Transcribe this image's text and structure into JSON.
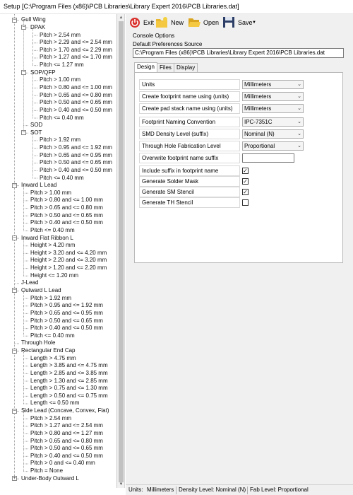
{
  "window": {
    "title": "Setup [C:\\Program Files (x86)\\PCB Libraries\\Library Expert 2016\\PCB Libraries.dat]"
  },
  "toolbar": {
    "exit_label": "Exit",
    "new_label": "New",
    "open_label": "Open",
    "save_label": "Save"
  },
  "console": {
    "group_label": "Console Options",
    "pref_label": "Default Preferences Source",
    "pref_path": "C:\\Program Files (x86)\\PCB Libraries\\Library Expert 2016\\PCB Libraries.dat"
  },
  "tabs": [
    {
      "label": "Design",
      "active": true
    },
    {
      "label": "Files",
      "active": false
    },
    {
      "label": "Display",
      "active": false
    }
  ],
  "properties": [
    {
      "label": "Units",
      "kind": "select",
      "value": "Millimeters"
    },
    {
      "label": "Create footprint name using (units)",
      "kind": "select",
      "value": "Millimeters"
    },
    {
      "label": "Create pad stack name using (units)",
      "kind": "select",
      "value": "Millimeters"
    },
    {
      "label": "Footprint Naming Convention",
      "kind": "select",
      "value": "IPC-7351C"
    },
    {
      "label": "SMD Density Level (suffix)",
      "kind": "select",
      "value": "Nominal (N)"
    },
    {
      "label": "Through Hole Fabrication Level",
      "kind": "select",
      "value": "Proportional"
    },
    {
      "label": "Overwrite footprint name suffix",
      "kind": "text",
      "value": ""
    },
    {
      "label": "Include suffix in footprint name",
      "kind": "check",
      "checked": true
    },
    {
      "label": "Generate Solder Mask",
      "kind": "check",
      "checked": true
    },
    {
      "label": "Generate SM Stencil",
      "kind": "check",
      "checked": true
    },
    {
      "label": "Generate TH Stencil",
      "kind": "check",
      "checked": false
    }
  ],
  "status": {
    "units_label": "Units:",
    "units_value": "Millimeters",
    "density": "Density Level: Nominal (N)",
    "fab": "Fab Level: Proportional"
  },
  "tree": [
    {
      "text": "Gull Wing",
      "level": 1,
      "expanded": true
    },
    {
      "text": "DPAK",
      "level": 2,
      "expanded": true
    },
    {
      "text": "Pitch > 2.54 mm",
      "level": 3
    },
    {
      "text": "Pitch > 2.29 and <= 2.54 mm",
      "level": 3
    },
    {
      "text": "Pitch > 1.70 and <= 2.29 mm",
      "level": 3
    },
    {
      "text": "Pitch > 1.27 and <= 1.70 mm",
      "level": 3
    },
    {
      "text": "Pitch <= 1.27 mm",
      "level": 3
    },
    {
      "text": "SOP/QFP",
      "level": 2,
      "expanded": true
    },
    {
      "text": "Pitch > 1.00 mm",
      "level": 3
    },
    {
      "text": "Pitch > 0.80 and <= 1.00 mm",
      "level": 3
    },
    {
      "text": "Pitch > 0.65 and <= 0.80 mm",
      "level": 3
    },
    {
      "text": "Pitch > 0.50 and <= 0.65 mm",
      "level": 3
    },
    {
      "text": "Pitch > 0.40 and <= 0.50 mm",
      "level": 3
    },
    {
      "text": "Pitch <= 0.40 mm",
      "level": 3
    },
    {
      "text": "SOD",
      "level": 2
    },
    {
      "text": "SOT",
      "level": 2,
      "expanded": true
    },
    {
      "text": "Pitch > 1.92 mm",
      "level": 3
    },
    {
      "text": "Pitch > 0.95 and <= 1.92 mm",
      "level": 3
    },
    {
      "text": "Pitch > 0.65 and <= 0.95 mm",
      "level": 3
    },
    {
      "text": "Pitch > 0.50 and <= 0.65 mm",
      "level": 3
    },
    {
      "text": "Pitch > 0.40 and <= 0.50 mm",
      "level": 3
    },
    {
      "text": "Pitch <= 0.40 mm",
      "level": 3
    },
    {
      "text": "Inward L Lead",
      "level": 1,
      "expanded": true
    },
    {
      "text": "Pitch > 1.00 mm",
      "level": 2
    },
    {
      "text": "Pitch > 0.80 and <= 1.00 mm",
      "level": 2
    },
    {
      "text": "Pitch > 0.65 and <= 0.80 mm",
      "level": 2
    },
    {
      "text": "Pitch > 0.50 and <= 0.65 mm",
      "level": 2
    },
    {
      "text": "Pitch > 0.40 and <= 0.50 mm",
      "level": 2
    },
    {
      "text": "Pitch <= 0.40 mm",
      "level": 2
    },
    {
      "text": "Inward Flat Ribbon L",
      "level": 1,
      "expanded": true
    },
    {
      "text": "Height > 4.20 mm",
      "level": 2
    },
    {
      "text": "Height > 3.20 and <= 4.20 mm",
      "level": 2
    },
    {
      "text": "Height > 2.20 and <= 3.20 mm",
      "level": 2
    },
    {
      "text": "Height > 1.20 and <= 2.20 mm",
      "level": 2
    },
    {
      "text": "Height <= 1.20 mm",
      "level": 2
    },
    {
      "text": "J-Lead",
      "level": 1
    },
    {
      "text": "Outward L Lead",
      "level": 1,
      "expanded": true
    },
    {
      "text": "Pitch > 1.92 mm",
      "level": 2
    },
    {
      "text": "Pitch > 0.95 and <= 1.92 mm",
      "level": 2
    },
    {
      "text": "Pitch > 0.65 and <= 0.95 mm",
      "level": 2
    },
    {
      "text": "Pitch > 0.50 and <= 0.65 mm",
      "level": 2
    },
    {
      "text": "Pitch > 0.40 and <= 0.50 mm",
      "level": 2
    },
    {
      "text": "Pitch <= 0.40 mm",
      "level": 2
    },
    {
      "text": "Through Hole",
      "level": 1
    },
    {
      "text": "Rectangular End Cap",
      "level": 1,
      "expanded": true
    },
    {
      "text": "Length > 4.75 mm",
      "level": 2
    },
    {
      "text": "Length > 3.85 and <= 4.75 mm",
      "level": 2
    },
    {
      "text": "Length > 2.85 and <= 3.85 mm",
      "level": 2
    },
    {
      "text": "Length > 1.30 and <= 2.85 mm",
      "level": 2
    },
    {
      "text": "Length > 0.75 and <= 1.30 mm",
      "level": 2
    },
    {
      "text": "Length > 0.50  and <= 0.75 mm",
      "level": 2
    },
    {
      "text": "Length <= 0.50 mm",
      "level": 2
    },
    {
      "text": "Side Lead (Concave, Convex, Flat)",
      "level": 1,
      "expanded": true
    },
    {
      "text": "Pitch > 2.54 mm",
      "level": 2
    },
    {
      "text": "Pitch > 1.27 and <= 2.54 mm",
      "level": 2
    },
    {
      "text": "Pitch > 0.80 and <= 1.27 mm",
      "level": 2
    },
    {
      "text": "Pitch > 0.65 and <= 0.80 mm",
      "level": 2
    },
    {
      "text": "Pitch > 0.50 and <= 0.65 mm",
      "level": 2
    },
    {
      "text": "Pitch > 0.40 and <= 0.50 mm",
      "level": 2
    },
    {
      "text": "Pitch > 0 and <= 0.40 mm",
      "level": 2
    },
    {
      "text": "Pitch = None",
      "level": 2
    },
    {
      "text": "Under-Body Outward L",
      "level": 1,
      "expanded": false
    }
  ]
}
